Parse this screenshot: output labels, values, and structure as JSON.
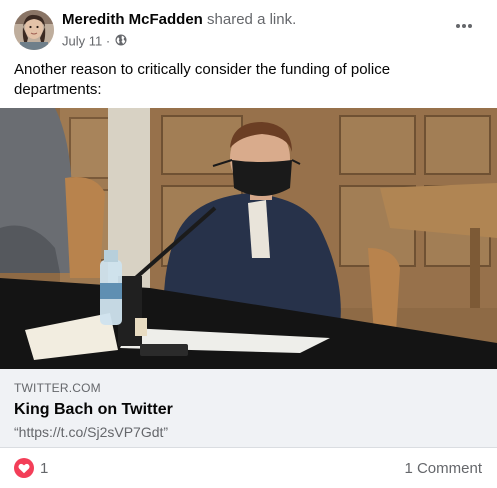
{
  "post": {
    "author": "Meredith McFadden",
    "action": "shared a link.",
    "date": "July 11",
    "separator": "·",
    "privacy_icon": "globe-icon",
    "more_icon": "more-horizontal-icon",
    "text": "Another reason to critically consider the funding of police departments:"
  },
  "link_card": {
    "domain": "TWITTER.COM",
    "title": "King Bach on Twitter",
    "description": "“https://t.co/Sj2sVP7Gdt”"
  },
  "footer": {
    "reaction_icon": "love-reaction-icon",
    "reaction_count": "1",
    "comments": "1 Comment"
  },
  "colors": {
    "text_primary": "#050505",
    "text_secondary": "#65676b",
    "card_bg": "#f0f2f5",
    "love_red": "#f33e58"
  }
}
